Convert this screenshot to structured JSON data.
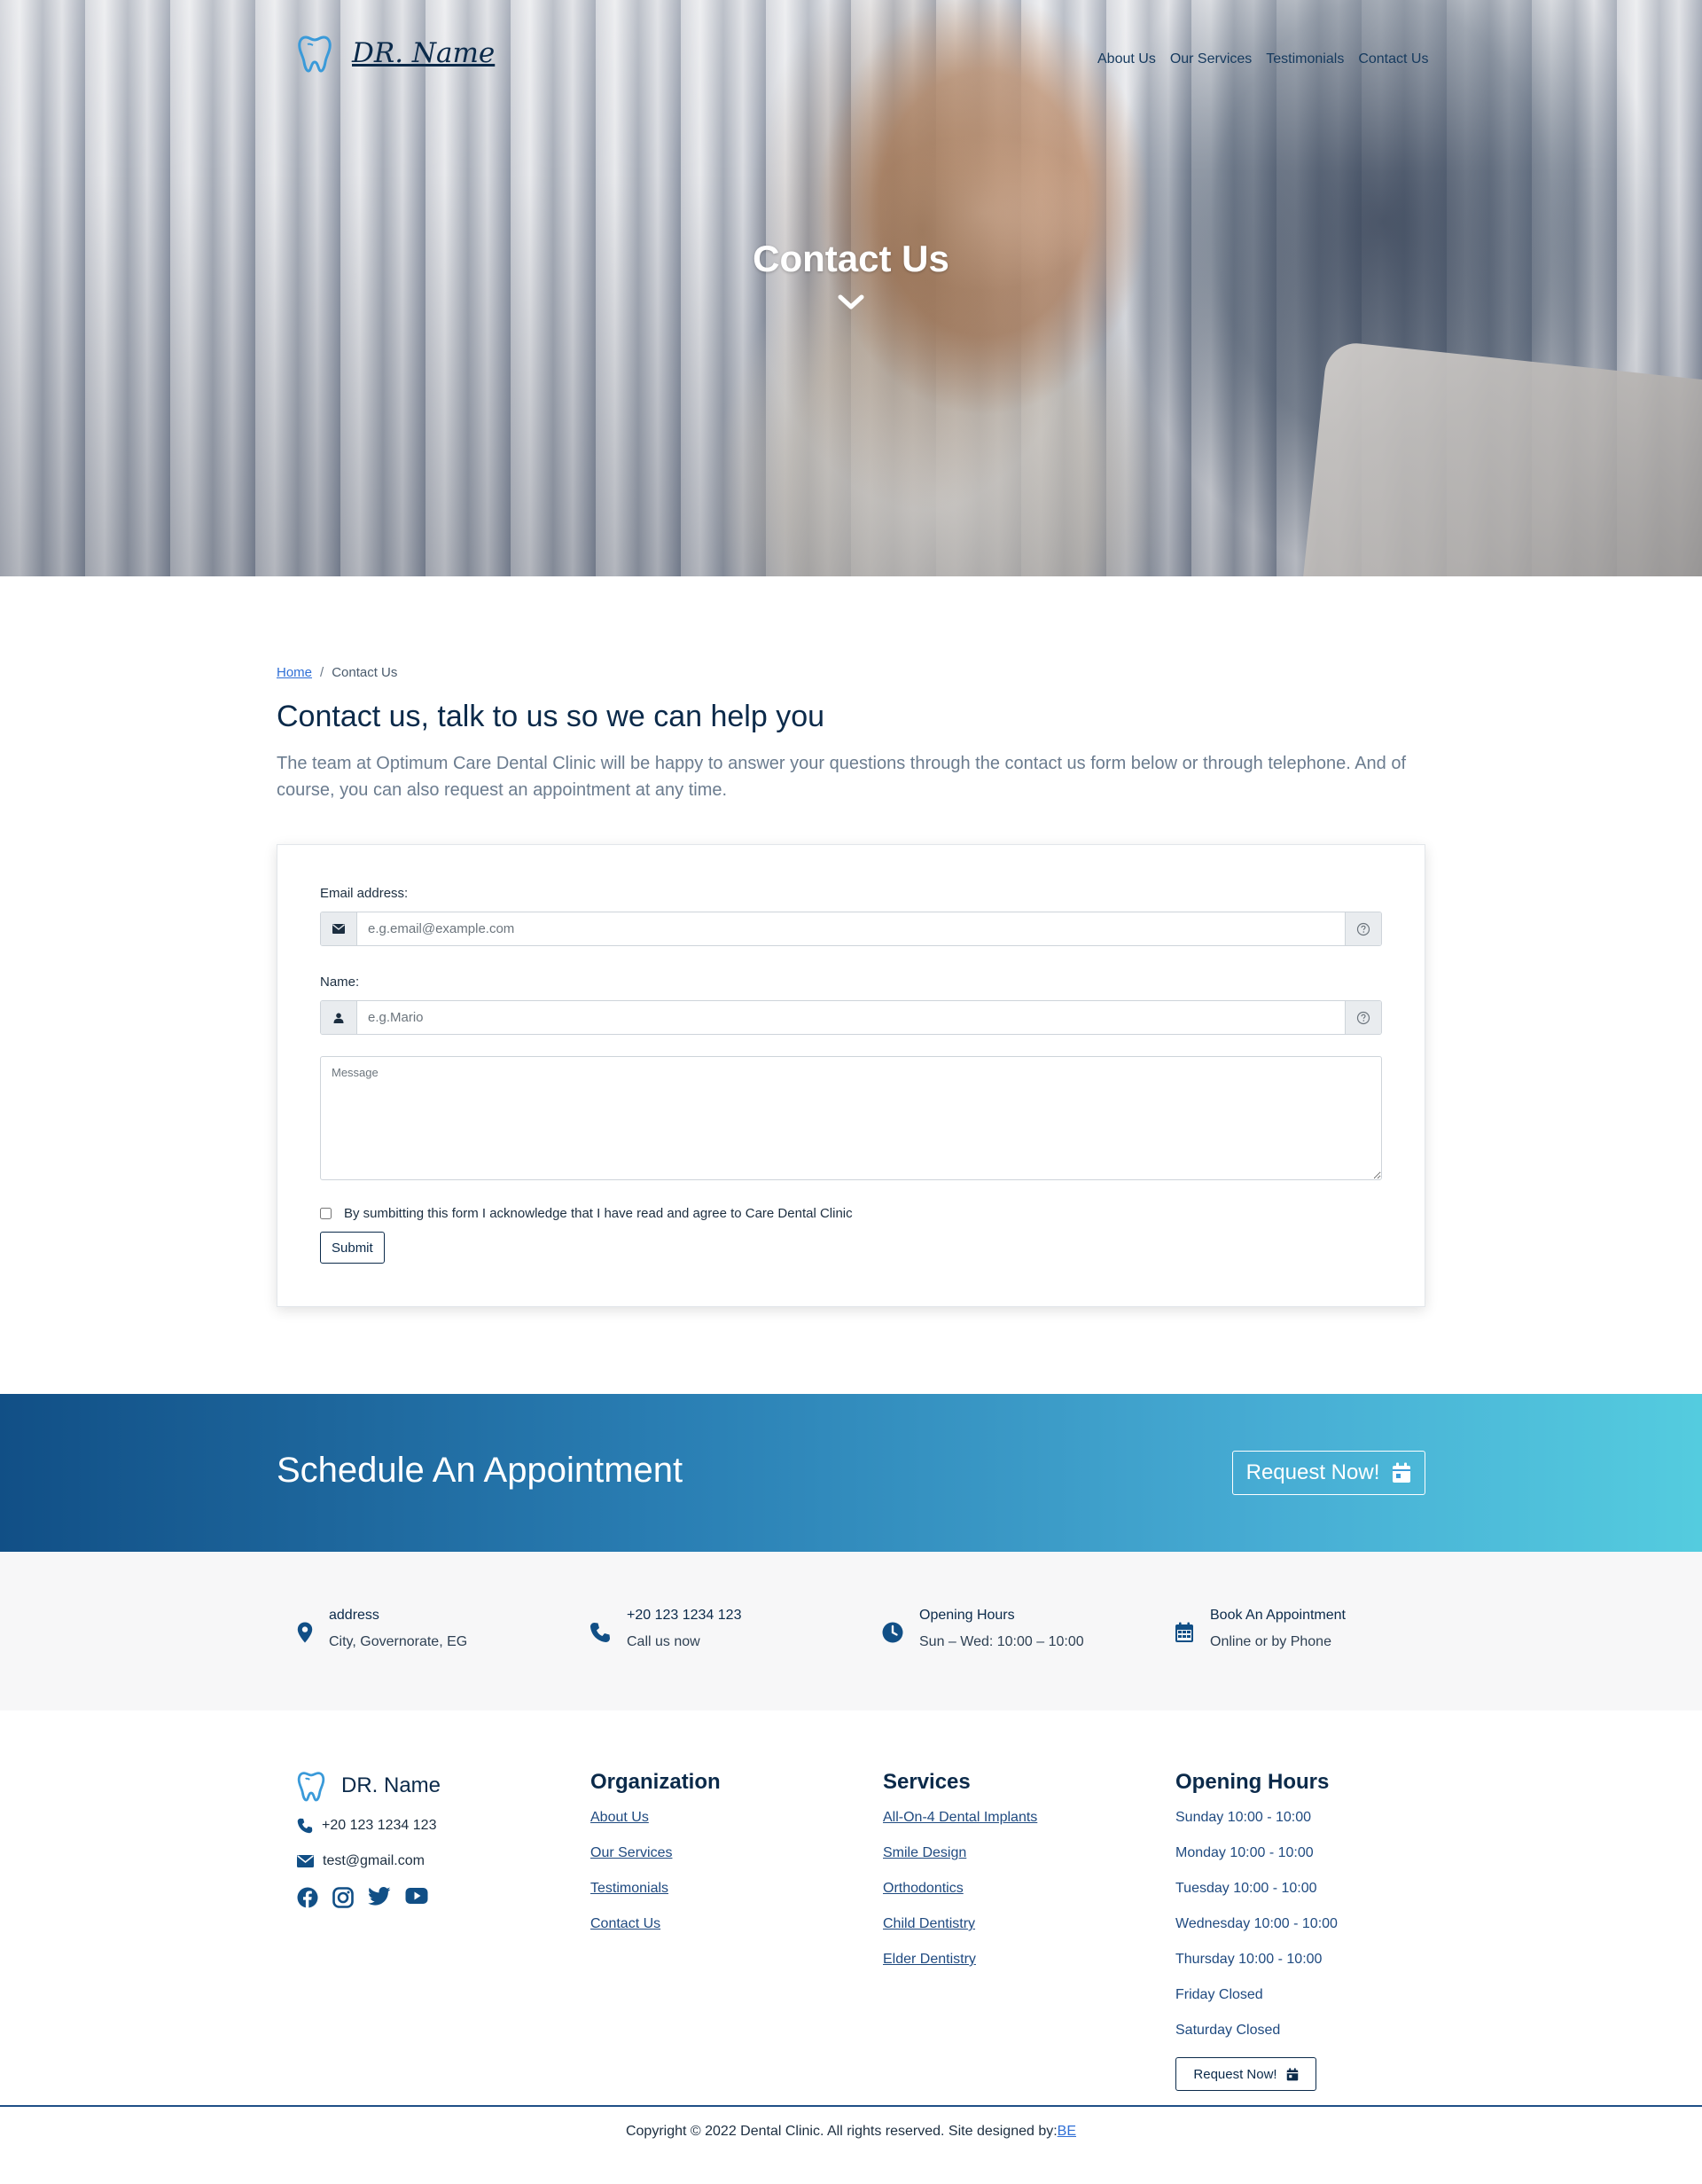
{
  "brand": {
    "name": "DR. Name",
    "accent_color": "#3a9ad9",
    "navy_color": "#0b2a4a"
  },
  "nav": {
    "links": [
      "About Us",
      "Our Services",
      "Testimonials",
      "Contact Us"
    ]
  },
  "hero": {
    "title": "Contact Us",
    "scroll_icon": "chevron-down-icon"
  },
  "breadcrumb": {
    "home": "Home",
    "separator": "/",
    "current": "Contact Us"
  },
  "main": {
    "title": "Contact us, talk to us so we can help you",
    "intro": "The team at Optimum Care Dental Clinic will be happy to answer your questions through the contact us form below or through telephone. And of course, you can also request an appointment at any time."
  },
  "form": {
    "email_label": "Email address:",
    "email_placeholder": "e.g.email@example.com",
    "email_icon": "envelope-icon",
    "name_label": "Name:",
    "name_placeholder": "e.g.Mario",
    "name_icon": "user-icon",
    "help_icon": "question-circle-icon",
    "message_placeholder": "Message",
    "consent_text": "By sumbitting this form I acknowledge that I have read and agree to Care Dental Clinic",
    "submit_label": "Submit"
  },
  "cta": {
    "title": "Schedule An Appointment",
    "button_label": "Request Now!",
    "button_icon": "calendar-icon",
    "gradient": [
      "#114f86",
      "#54ccdf"
    ]
  },
  "info": [
    {
      "title": "address",
      "subtitle": "City, Governorate, EG",
      "icon": "map-marker-icon"
    },
    {
      "title": "+20 123 1234 123",
      "subtitle": "Call us now",
      "icon": "phone-icon"
    },
    {
      "title": "Opening Hours",
      "subtitle": "Sun – Wed: 10:00 – 10:00",
      "icon": "clock-icon"
    },
    {
      "title": "Book An Appointment",
      "subtitle": "Online or by Phone",
      "icon": "calendar-grid-icon"
    }
  ],
  "footer": {
    "brand_name": "DR. Name",
    "phone": "+20 123 1234 123",
    "email": "test@gmail.com",
    "social": [
      "facebook-icon",
      "instagram-icon",
      "twitter-icon",
      "youtube-icon"
    ],
    "organization": {
      "heading": "Organization",
      "links": [
        "About Us",
        "Our Services",
        "Testimonials",
        "Contact Us"
      ]
    },
    "services": {
      "heading": "Services",
      "links": [
        "All-On-4 Dental Implants",
        "Smile Design",
        "Orthodontics",
        "Child Dentistry",
        "Elder Dentistry"
      ]
    },
    "hours": {
      "heading": "Opening Hours",
      "items": [
        "Sunday 10:00 - 10:00",
        "Monday 10:00 - 10:00",
        "Tuesday 10:00 - 10:00",
        "Wednesday 10:00 - 10:00",
        "Thursday 10:00 - 10:00",
        "Friday Closed",
        "Saturday Closed"
      ],
      "button_label": "Request Now!"
    },
    "copyright": "Copyright © 2022 Dental Clinic. All rights reserved. Site designed by:",
    "designer": "BE"
  }
}
